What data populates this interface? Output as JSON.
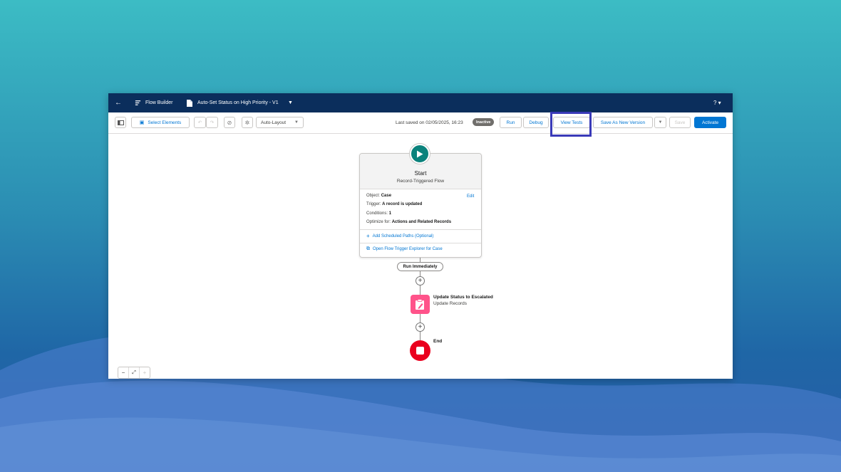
{
  "header": {
    "app_label": "Flow Builder",
    "flow_title": "Auto-Set Status on High Priority - V1",
    "help_label": "? ▾"
  },
  "toolbar": {
    "select_elements_label": "Select Elements",
    "layout_select_value": "Auto-Layout",
    "last_saved": "Last saved on 02/05/2025, 16:23",
    "status_badge": "Inactive",
    "run_label": "Run",
    "debug_label": "Debug",
    "view_tests_label": "View Tests",
    "save_as_new_version_label": "Save As New Version",
    "save_label": "Save",
    "activate_label": "Activate"
  },
  "start_card": {
    "title": "Start",
    "subtitle": "Record-Triggered Flow",
    "object_label": "Object:",
    "object_value": "Case",
    "trigger_label": "Trigger:",
    "trigger_value": "A record is updated",
    "conditions_label": "Conditions:",
    "conditions_value": "1",
    "optimize_label": "Optimize for:",
    "optimize_value": "Actions and Related Records",
    "edit_label": "Edit",
    "add_paths_label": "Add Scheduled Paths (Optional)",
    "trigger_explorer_label": "Open Flow Trigger Explorer for Case"
  },
  "path_label": "Run Immediately",
  "update_element": {
    "title": "Update Status to Escalated",
    "subtitle": "Update Records"
  },
  "end_label": "End",
  "colors": {
    "header_bg": "#0b2e5c",
    "brand": "#0176d3",
    "start_node": "#0b827c",
    "update_node": "#ff538a",
    "end_node": "#ea001e",
    "highlight": "#3a3ab8"
  }
}
